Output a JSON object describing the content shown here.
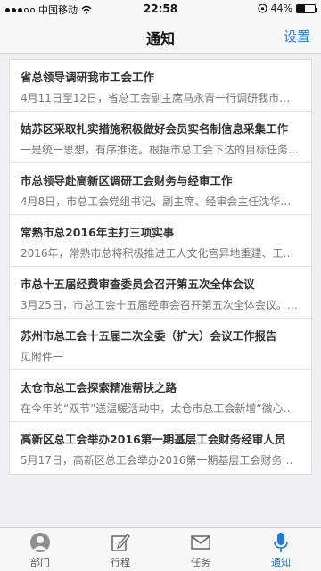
{
  "status_bar": {
    "carrier": "中国移动",
    "time": "22:58",
    "battery": "44%",
    "battery_level": 0.44
  },
  "nav": {
    "title": "通知",
    "action": "设置"
  },
  "notices": [
    {
      "title": "省总领导调研我市工会工作",
      "summary": "4月11日至12日，省总工会副主席马永青一行调研我市工会…"
    },
    {
      "title": "姑苏区采取扎实措施积极做好会员实名制信息采集工作",
      "summary": "一是统一思想，有序推进。根据市总工会下达的目标任务…"
    },
    {
      "title": "市总领导赴高新区调研工会财务与经审工作",
      "summary": "4月8日，市总工会党组书记、副主席、经审会主任沈华…"
    },
    {
      "title": "常熟市总2016年主打三项实事",
      "summary": "2016年，常熟市总将积极推进工人文化宫异地重建、工…"
    },
    {
      "title": "市总十五届经费审查委员会召开第五次全体会议",
      "summary": "3月25日，市总工会十五届经审会召开第五次全体会议。…"
    },
    {
      "title": "苏州市总工会十五届二次全委（扩大）会议工作报告",
      "summary": "见附件一"
    },
    {
      "title": "太仓市总工会探索精准帮扶之路",
      "summary": "在今年的“双节”送温暖活动中，太仓市总工会新增“微心…"
    },
    {
      "title": "高新区总工会举办2016第一期基层工会财务经审人员",
      "summary": "5月17日，高新区总工会举办2016第一期基层工会财务经…"
    }
  ],
  "tabs": [
    {
      "label": "部门",
      "icon": "person-icon"
    },
    {
      "label": "行程",
      "icon": "edit-icon"
    },
    {
      "label": "任务",
      "icon": "mail-icon"
    },
    {
      "label": "通知",
      "icon": "microphone-icon"
    }
  ],
  "colors": {
    "accent": "#1a7be0",
    "background": "#efeff4"
  }
}
